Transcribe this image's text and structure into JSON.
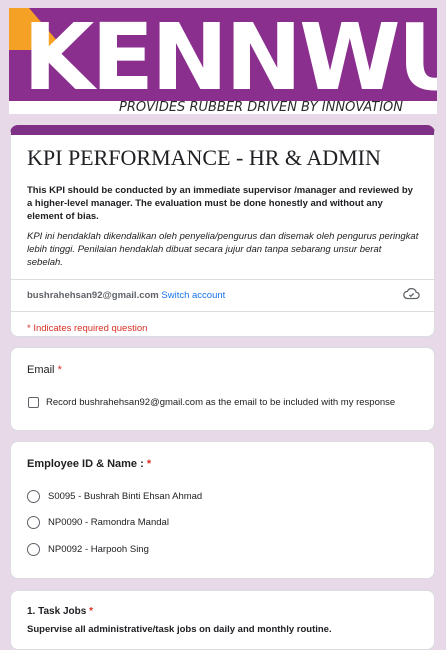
{
  "banner": {
    "logo_text": "KENNWU",
    "tagline": "PROVIDES RUBBER DRIVEN BY INNOVATION"
  },
  "form": {
    "title": "KPI PERFORMANCE - HR & ADMIN",
    "description_en": "This KPI should be conducted by an immediate supervisor /manager and reviewed by a higher-level manager. The evaluation must be done honestly and without any element of bias.",
    "description_ms": "KPI ini hendaklah dikendalikan oleh penyelia/pengurus dan disemak oleh pengurus peringkat lebih tinggi. Penilaian hendaklah dibuat secara jujur dan tanpa sebarang unsur berat sebelah.",
    "account_email": "bushrahehsan92@gmail.com",
    "switch_account": "Switch account",
    "required_note": "* Indicates required question"
  },
  "questions": {
    "email": {
      "title": "Email",
      "required_mark": "*",
      "checkbox_label": "Record bushrahehsan92@gmail.com as the email to be included with my response"
    },
    "employee": {
      "title": "Employee ID & Name :",
      "required_mark": "*",
      "options": [
        "S0095 - Bushrah Binti Ehsan Ahmad",
        "NP0090 - Ramondra Mandal",
        "NP0092 - Harpooh Sing"
      ]
    },
    "task_jobs": {
      "title": "1. Task Jobs",
      "required_mark": "*",
      "subtitle": "Supervise all administrative/task jobs on daily and monthly routine."
    }
  },
  "colors": {
    "brand_purple": "#8b2f8e",
    "brand_orange": "#f5a126",
    "page_background": "#e8d9e9",
    "required_red": "#d93025",
    "link_blue": "#1a73e8"
  }
}
